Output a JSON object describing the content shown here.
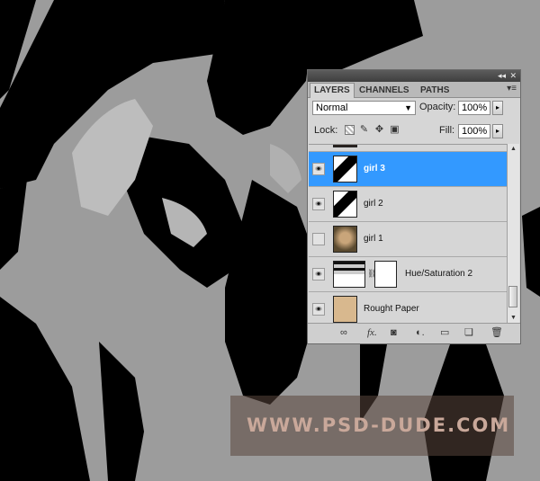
{
  "panel": {
    "tabs": [
      "LAYERS",
      "CHANNELS",
      "PATHS"
    ],
    "blend_mode": "Normal",
    "opacity_label": "Opacity:",
    "opacity_value": "100%",
    "lock_label": "Lock:",
    "fill_label": "Fill:",
    "fill_value": "100%",
    "layers": [
      {
        "name": "girl 3",
        "visible": true,
        "selected": true
      },
      {
        "name": "girl 2",
        "visible": true,
        "selected": false
      },
      {
        "name": "girl 1",
        "visible": false,
        "selected": false
      },
      {
        "name": "Hue/Saturation 2",
        "visible": true,
        "selected": false
      },
      {
        "name": "Rought Paper",
        "visible": true,
        "selected": false
      }
    ],
    "bottom_icons": [
      "link-layers-icon",
      "fx-icon",
      "add-mask-icon",
      "adjustment-layer-icon",
      "new-group-icon",
      "new-layer-icon",
      "trash-icon"
    ]
  },
  "watermark": {
    "text": "WWW.PSD-DUDE.COM"
  },
  "colors": {
    "selection": "#3399ff",
    "panel_bg": "#d6d6d6"
  }
}
